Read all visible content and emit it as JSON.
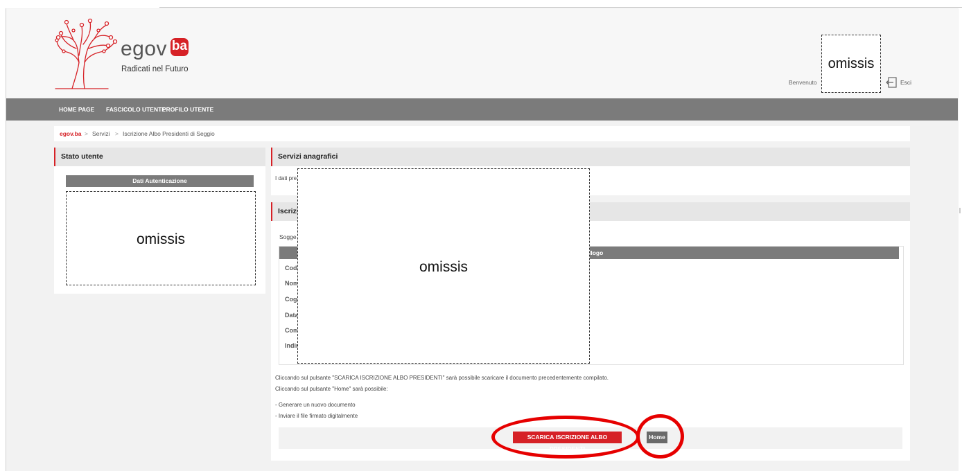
{
  "header": {
    "logo_text": "egov",
    "logo_badge": "ba",
    "tagline": "Radicati nel Futuro",
    "welcome_label": "Benvenuto",
    "user_name": "omissis",
    "logout_label": "Esci"
  },
  "nav": {
    "items": [
      "HOME PAGE",
      "FASCICOLO UTENTE",
      "PROFILO UTENTE"
    ]
  },
  "breadcrumb": {
    "root": "egov.ba",
    "items": [
      "Servizi",
      "Iscrizione Albo Presidenti di Seggio"
    ],
    "separator": ">"
  },
  "left_panel": {
    "title": "Stato utente",
    "auth_header": "Dati Autenticazione",
    "auth_content": "omissis"
  },
  "services_panel": {
    "title": "Servizi anagrafici",
    "intro": "I dati pre"
  },
  "form_panel": {
    "title": "Iscrizi",
    "subject_label": "Sogge",
    "table_header_tail": "llogo",
    "fields": [
      "Cod",
      "Nom",
      "Cogn",
      "Data",
      "Com",
      "Indir"
    ],
    "redacted": "omissis",
    "instructions": [
      "Cliccando sul pulsante \"SCARICA ISCRIZIONE ALBO PRESIDENTI\" sarà possibile scaricare il documento precedentemente compilato.",
      "Cliccando sul pulsante \"Home\" sarà possibile:"
    ],
    "bullets": [
      "- Generare un nuovo documento",
      "- Inviare il file firmato digitalmente"
    ],
    "download_button": "SCARICA ISCRIZIONE ALBO PRESIDENTI",
    "home_button": "Home"
  },
  "colors": {
    "accent": "#d62126",
    "nav_bg": "#7b7b7b",
    "annotation": "#e60000"
  }
}
